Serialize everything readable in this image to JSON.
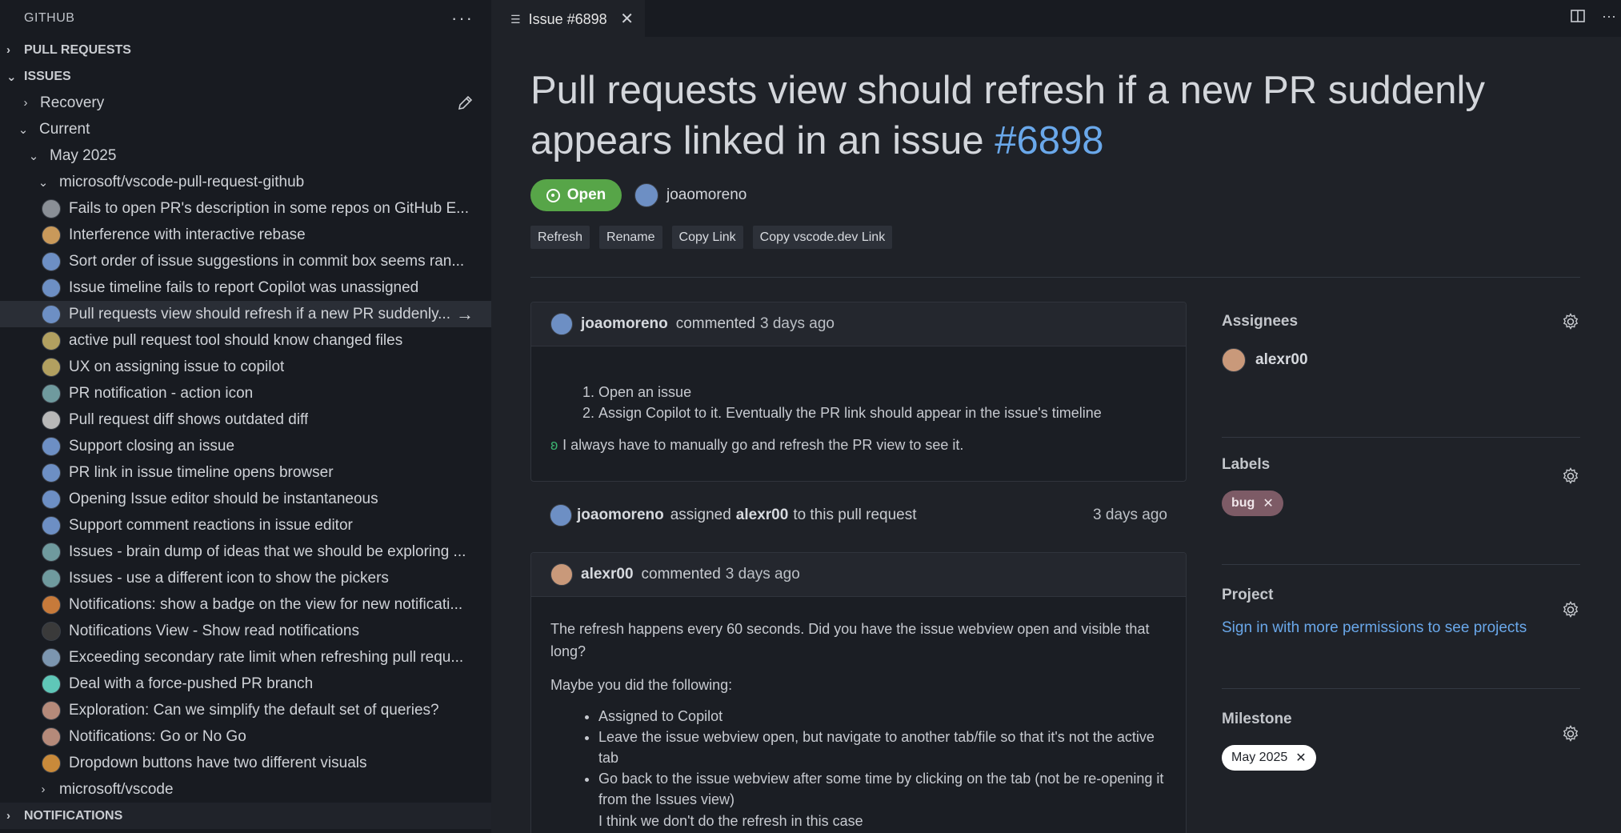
{
  "sidebar": {
    "title": "GITHUB",
    "more": "···",
    "sections": {
      "pull_requests": "PULL REQUESTS",
      "issues": "ISSUES",
      "notifications": "NOTIFICATIONS"
    },
    "recovery": "Recovery",
    "current": "Current",
    "milestone": "May 2025",
    "repo": "microsoft/vscode-pull-request-github",
    "repo2": "microsoft/vscode",
    "issues": [
      {
        "label": "Fails to open PR's description in some repos on GitHub E...",
        "color": "#8a8f96"
      },
      {
        "label": "Interference with interactive rebase",
        "color": "#c9995a"
      },
      {
        "label": "Sort order of issue suggestions in commit box seems ran...",
        "color": "#6d8fc4"
      },
      {
        "label": "Issue timeline fails to report Copilot was unassigned",
        "color": "#6d8fc4"
      },
      {
        "label": "Pull requests view should refresh if a new PR suddenly...",
        "color": "#6d8fc4"
      },
      {
        "label": "active pull request tool should know changed files",
        "color": "#b2a060"
      },
      {
        "label": "UX on assigning issue to copilot",
        "color": "#b2a060"
      },
      {
        "label": "PR notification - action icon",
        "color": "#6f9a9e"
      },
      {
        "label": "Pull request diff shows outdated diff",
        "color": "#b8b8b8"
      },
      {
        "label": "Support closing an issue",
        "color": "#6d8fc4"
      },
      {
        "label": "PR link in issue timeline opens browser",
        "color": "#6d8fc4"
      },
      {
        "label": "Opening Issue editor should be instantaneous",
        "color": "#6d8fc4"
      },
      {
        "label": "Support comment reactions in issue editor",
        "color": "#6d8fc4"
      },
      {
        "label": "Issues - brain dump of ideas that we should be exploring ...",
        "color": "#6f9a9e"
      },
      {
        "label": "Issues - use a different icon to show the pickers",
        "color": "#6f9a9e"
      },
      {
        "label": "Notifications: show a badge on the view for new notificati...",
        "color": "#c77a3a"
      },
      {
        "label": "Notifications View - Show read notifications",
        "color": "#3a3a3a"
      },
      {
        "label": "Exceeding secondary rate limit when refreshing pull requ...",
        "color": "#7c96b0"
      },
      {
        "label": "Deal with a force-pushed PR branch",
        "color": "#5fc7b8"
      },
      {
        "label": "Exploration: Can we simplify the default set of queries?",
        "color": "#b58a7a"
      },
      {
        "label": "Notifications: Go or No Go",
        "color": "#b58a7a"
      },
      {
        "label": "Dropdown buttons have two different visuals",
        "color": "#c98a3a"
      }
    ]
  },
  "tab": {
    "label": "Issue #6898",
    "close": "✕"
  },
  "issue": {
    "title": "Pull requests view should refresh if a new PR suddenly appears linked in an issue",
    "number": "#6898",
    "status": "Open",
    "author": "joaomoreno",
    "actions": [
      "Refresh",
      "Rename",
      "Copy Link",
      "Copy vscode.dev Link"
    ]
  },
  "comment1": {
    "author": "joaomoreno",
    "verb": "commented",
    "time": "3 days ago",
    "steps": [
      "Open an issue",
      "Assign Copilot to it. Eventually the PR link should appear in the issue's timeline"
    ],
    "note": "I always have to manually go and refresh the PR view to see it."
  },
  "event": {
    "actor": "joaomoreno",
    "verb": "assigned",
    "target": "alexr00",
    "suffix": "to this pull request",
    "time": "3 days ago"
  },
  "comment2": {
    "author": "alexr00",
    "verb": "commented",
    "time": "3 days ago",
    "p1": "The refresh happens every 60 seconds. Did you have the issue webview open and visible that long?",
    "p2": "Maybe you did the following:",
    "bullets": [
      "Assigned to Copilot",
      "Leave the issue webview open, but navigate to another tab/file so that it's not the active tab",
      "Go back to the issue webview after some time by clicking on the tab (not be re-opening it from the Issues view)"
    ],
    "p3": "I think we don't do the refresh in this case"
  },
  "side": {
    "assignees_title": "Assignees",
    "assignee": "alexr00",
    "labels_title": "Labels",
    "label": "bug",
    "label_color": "#7d5b66",
    "project_title": "Project",
    "project_link": "Sign in with more permissions to see projects",
    "milestone_title": "Milestone",
    "milestone": "May 2025"
  }
}
